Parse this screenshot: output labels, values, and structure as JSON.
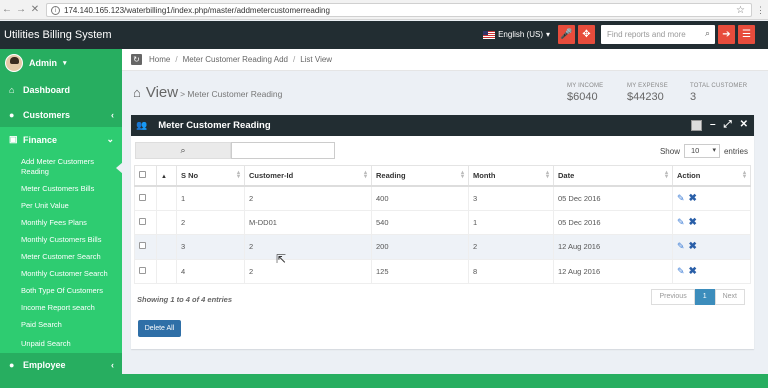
{
  "browser": {
    "url": "174.140.165.123/waterbilling1/index.php/master/addmetercustomerreading"
  },
  "header": {
    "brand": "Utilities Billing System",
    "language": "English (US)",
    "search_placeholder": "Find reports and more"
  },
  "sidebar": {
    "user": "Admin",
    "items": [
      {
        "label": "Dashboard"
      },
      {
        "label": "Customers"
      },
      {
        "label": "Finance"
      }
    ],
    "submenu": [
      "Add Meter Customers Reading",
      "Meter Customers Bills",
      "Per Unit Value",
      "Monthly Fees Plans",
      "Monthly Customers Bills",
      "Meter Customer Search",
      "Monthly Customer Search",
      "Both Type Of Customers",
      "Income Report search",
      "Paid Search",
      "Unpaid Search"
    ],
    "bottom_item": "Employee"
  },
  "breadcrumb": [
    "Home",
    "Meter Customer Reading Add",
    "List View"
  ],
  "page": {
    "view_label": "View",
    "subtitle": "> Meter Customer Reading"
  },
  "stats": [
    {
      "label": "MY INCOME",
      "value": "$6040"
    },
    {
      "label": "MY EXPENSE",
      "value": "$44230"
    },
    {
      "label": "TOTAL CUSTOMER",
      "value": "3"
    }
  ],
  "panel": {
    "title": "Meter Customer Reading",
    "show_label": "Show",
    "show_value": "10",
    "entries_label": "entries"
  },
  "table": {
    "columns": [
      "S No",
      "Customer-Id",
      "Reading",
      "Month",
      "Date",
      "Action"
    ],
    "rows": [
      [
        "1",
        "2",
        "400",
        "3",
        "05 Dec 2016"
      ],
      [
        "2",
        "M-DD01",
        "540",
        "1",
        "05 Dec 2016"
      ],
      [
        "3",
        "2",
        "200",
        "2",
        "12 Aug 2016"
      ],
      [
        "4",
        "2",
        "125",
        "8",
        "12 Aug 2016"
      ]
    ]
  },
  "info": "Showing 1 to 4 of 4 entries",
  "pager": {
    "previous": "Previous",
    "current": "1",
    "next": "Next"
  },
  "delete_all": "Delete All",
  "colors": {
    "sidebar": "#27ae60",
    "topbar": "#222d32",
    "accent_red": "#e74c3c",
    "primary": "#2f6fa7"
  }
}
